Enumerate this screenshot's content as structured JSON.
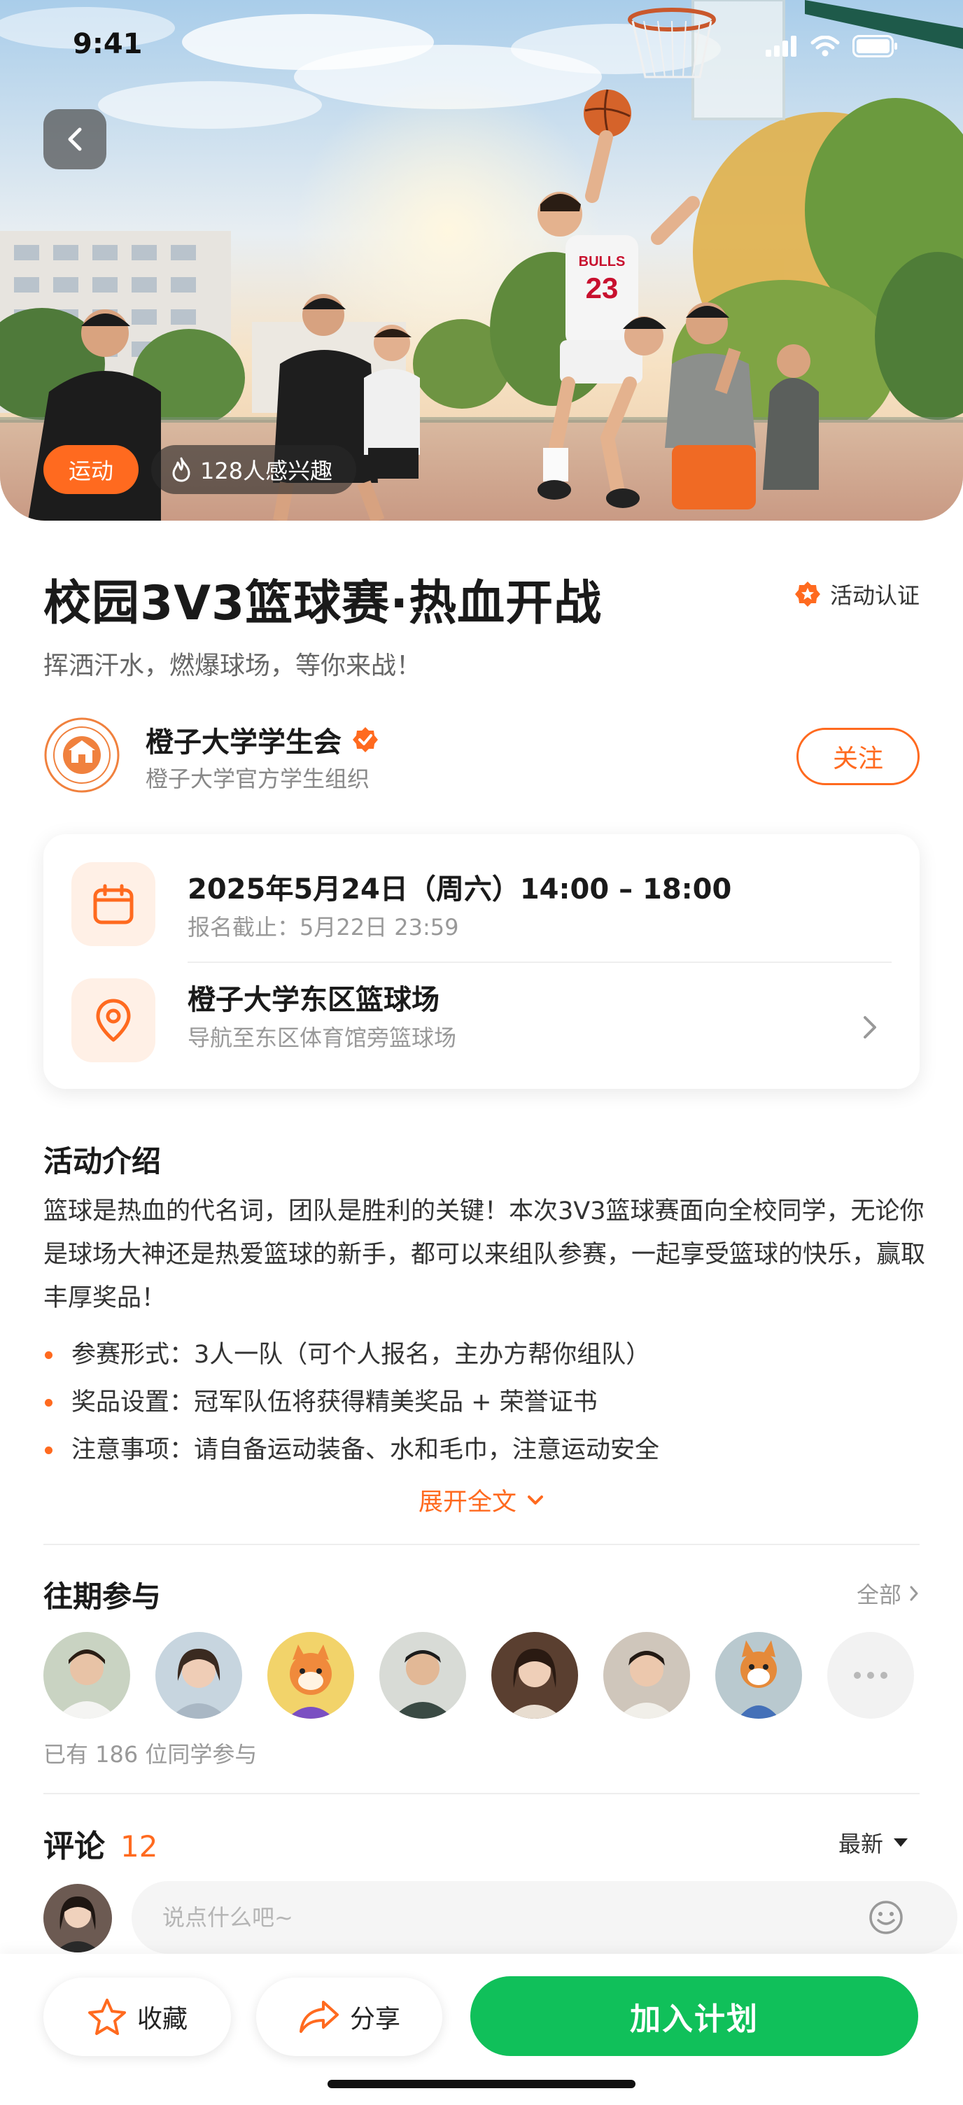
{
  "status": {
    "time": "9:41"
  },
  "hero": {
    "category_tag": "运动",
    "interest_text": "128人感兴趣",
    "jersey_team": "BULLS",
    "jersey_number": "23"
  },
  "event": {
    "title": "校园3V3篮球赛·热血开战",
    "verified_label": "活动认证",
    "subtitle": "挥洒汗水，燃爆球场，等你来战！"
  },
  "organizer": {
    "name": "橙子大学学生会",
    "description": "橙子大学官方学生组织",
    "follow_label": "关注"
  },
  "info": {
    "datetime": "2025年5月24日（周六）14:00 – 18:00",
    "deadline": "报名截止：5月22日 23:59",
    "location": "橙子大学东区篮球场",
    "navigation": "导航至东区体育馆旁篮球场"
  },
  "intro": {
    "title": "活动介绍",
    "text": "篮球是热血的代名词，团队是胜利的关键！本次3V3篮球赛面向全校同学，无论你是球场大神还是热爱篮球的新手，都可以来组队参赛，一起享受篮球的快乐，赢取丰厚奖品！",
    "bullets": [
      "参赛形式：3人一队（可个人报名，主办方帮你组队）",
      "奖品设置：冠军队伍将获得精美奖品 + 荣誉证书",
      "注意事项：请自备运动装备、水和毛巾，注意运动安全"
    ],
    "expand_label": "展开全文"
  },
  "participants": {
    "title": "往期参与",
    "see_all_label": "全部",
    "count_text": "已有 186 位同学参与"
  },
  "comments": {
    "title": "评论",
    "count": "12",
    "sort_label": "最新",
    "input_placeholder": "说点什么吧~"
  },
  "bottom": {
    "favorite_label": "收藏",
    "share_label": "分享",
    "join_label": "加入计划"
  },
  "colors": {
    "accent": "#ff6a1f",
    "join_green": "#10c05a"
  }
}
